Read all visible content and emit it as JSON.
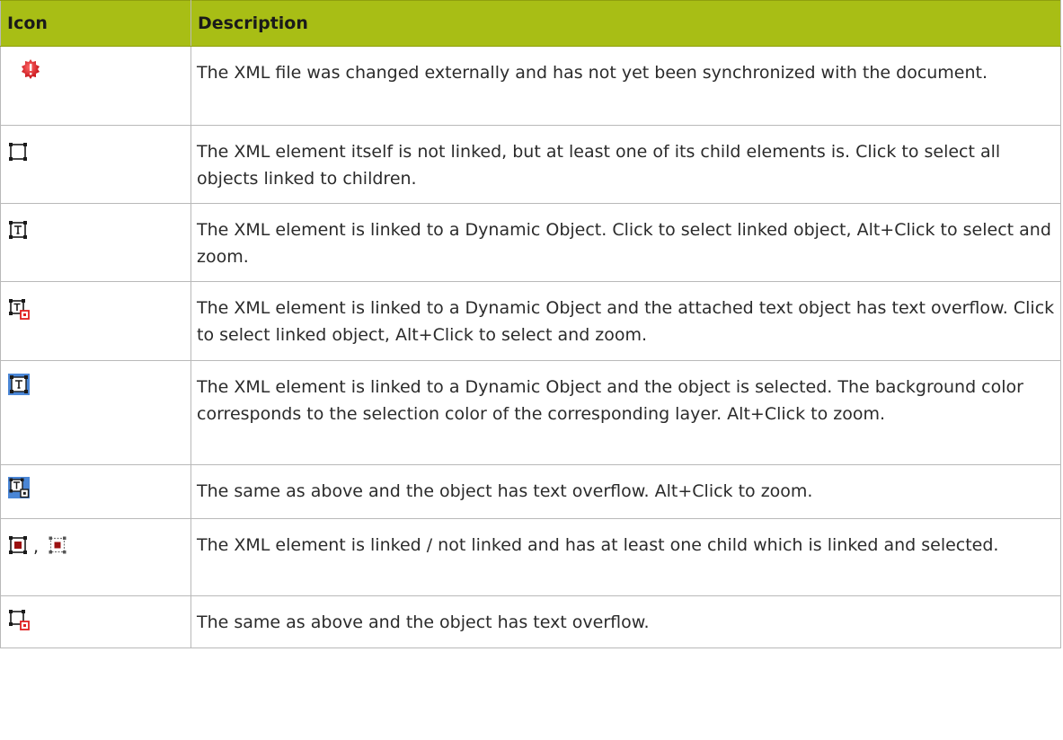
{
  "table": {
    "headers": {
      "icon": "Icon",
      "description": "Description"
    },
    "rows": [
      {
        "icon": "warning-gear-icon",
        "description": "The XML file was changed externally and has not yet been synchronized with the document."
      },
      {
        "icon": "child-linked-frame-icon",
        "description": "The XML element itself is not linked, but at least one of its child elements is. Click to select all objects linked to children."
      },
      {
        "icon": "linked-text-frame-icon",
        "description": "The XML element is linked to a Dynamic Object. Click to select linked object, Alt+Click to select and zoom."
      },
      {
        "icon": "linked-text-frame-overflow-icon",
        "description": "The XML element is linked to a Dynamic Object and the attached text object has text overflow. Click to select linked object, Alt+Click to select and zoom."
      },
      {
        "icon": "selected-linked-text-frame-icon",
        "description": "The XML element is linked to a Dynamic Object and the object is selected. The background color corresponds to the selection color of the corresponding layer. Alt+Click to zoom."
      },
      {
        "icon": "selected-linked-text-frame-overflow-icon",
        "description": "The same as above and the object has text overflow. Alt+Click to zoom."
      },
      {
        "icon": "child-selected-frame-icon",
        "icon_secondary": "child-selected-frame-small-icon",
        "separator": ",",
        "description": "The XML element is linked / not linked and has at least one child which is linked and selected."
      },
      {
        "icon": "child-frame-overflow-icon",
        "description": "The same as above and the object has text overflow."
      }
    ]
  },
  "colors": {
    "header_bg": "#a8be15",
    "border": "#b9b9b9",
    "warning_red": "#d8141b",
    "selection_blue": "#4a86d6",
    "overflow_red": "#e02020"
  }
}
